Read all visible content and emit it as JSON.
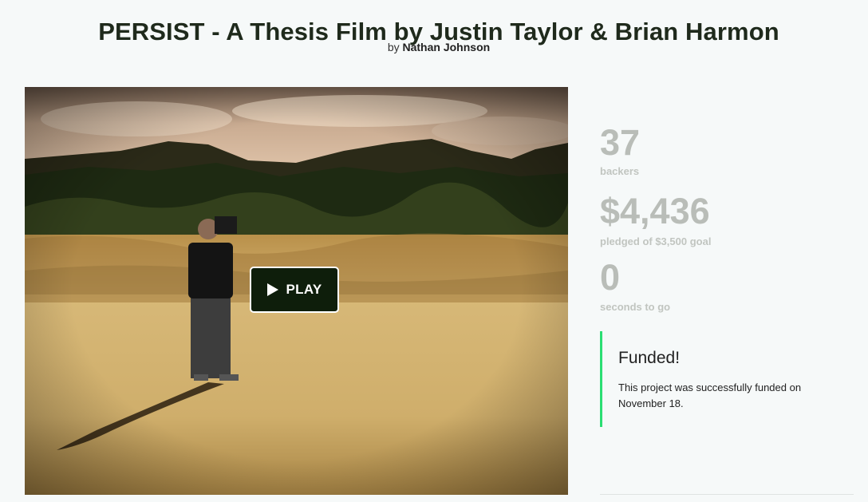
{
  "project": {
    "title": "PERSIST - A Thesis Film by Justin Taylor & Brian Harmon",
    "by_prefix": "by",
    "author": "Nathan Johnson"
  },
  "video": {
    "play_label": "PLAY",
    "play_icon": "play-triangle-icon"
  },
  "stats": {
    "backers": "37",
    "backers_label": "backers",
    "pledged": "$4,436",
    "pledged_label": "pledged of $3,500 goal",
    "time_left": "0",
    "time_label": "seconds to go"
  },
  "funded": {
    "title": "Funded!",
    "text": "This project was successfully funded on November 18.",
    "accent_color": "#2bde73"
  }
}
